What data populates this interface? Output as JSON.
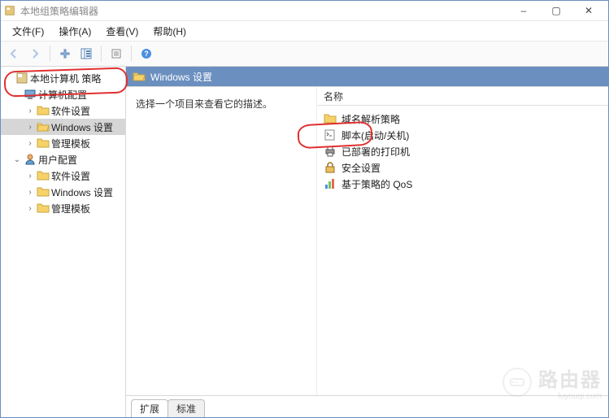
{
  "window": {
    "title": "本地组策略编辑器",
    "controls": {
      "min": "–",
      "max": "▢",
      "close": "✕"
    }
  },
  "menubar": [
    "文件(F)",
    "操作(A)",
    "查看(V)",
    "帮助(H)"
  ],
  "tree": {
    "root": "本地计算机 策略",
    "computer": {
      "label": "计算机配置",
      "software": "软件设置",
      "windows": "Windows 设置",
      "admin": "管理模板"
    },
    "user": {
      "label": "用户配置",
      "software": "软件设置",
      "windows": "Windows 设置",
      "admin": "管理模板"
    }
  },
  "content": {
    "header": "Windows 设置",
    "description": "选择一个项目来查看它的描述。",
    "name_col": "名称",
    "items": [
      "域名解析策略",
      "脚本(启动/关机)",
      "已部署的打印机",
      "安全设置",
      "基于策略的 QoS"
    ]
  },
  "tabs": {
    "extended": "扩展",
    "standard": "标准"
  },
  "watermark": {
    "text": "路由器",
    "sub": "luyouqi.com"
  }
}
